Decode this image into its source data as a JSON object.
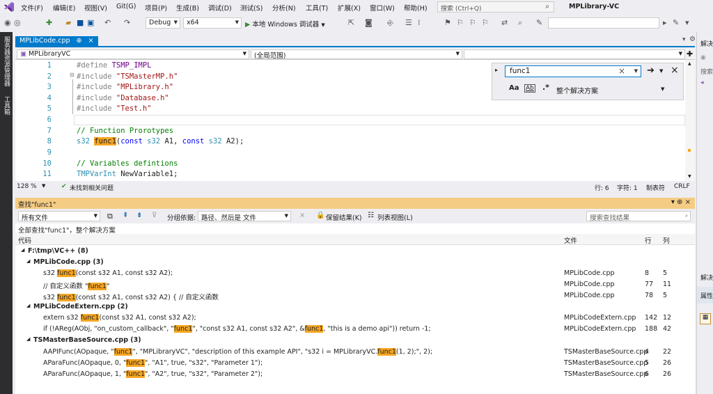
{
  "menubar": {
    "items": [
      "文件(F)",
      "编辑(E)",
      "视图(V)",
      "Git(G)",
      "项目(P)",
      "生成(B)",
      "调试(D)",
      "测试(S)",
      "分析(N)",
      "工具(T)",
      "扩展(X)",
      "窗口(W)",
      "帮助(H)"
    ],
    "search_placeholder": "搜索 (Ctrl+Q)",
    "app_title": "MPLibrary-VC"
  },
  "toolbar": {
    "config": "Debug",
    "platform": "x64",
    "run_label": "本地 Windows 调试器"
  },
  "left_strip": {
    "tab1": "服务器资源管理器",
    "tab2": "工具箱"
  },
  "doc_tab": {
    "label": "MPLibCode.cpp",
    "pin": "⊕",
    "close": "×"
  },
  "nav": {
    "project": "MPLibraryVC",
    "scope": "(全局范围)"
  },
  "editor": {
    "lines": [
      "1",
      "2",
      "3",
      "4",
      "5",
      "6",
      "7",
      "8",
      "9",
      "10",
      "11"
    ],
    "line1_kw": "#define",
    "line1_rest": " TSMP_IMPL",
    "line2_kw": "#include",
    "line2_str": " \"TSMasterMP.h\"",
    "line3_kw": "#include",
    "line3_str": " \"MPLibrary.h\"",
    "line4_kw": "#include",
    "line4_str": " \"Database.h\"",
    "line5_kw": "#include",
    "line5_str": " \"Test.h\"",
    "line7": "// Function Prorotypes",
    "line8_type": "s32",
    "line8_func": "func1",
    "line8_rest": "(",
    "line8_c1": "const",
    "line8_t1": " s32",
    "line8_a1": " A1, ",
    "line8_c2": "const",
    "line8_t2": " s32",
    "line8_a2": " A2);",
    "line10": "// Variables defintions",
    "line11_type": "TMPVarInt",
    "line11_rest": " NewVariable1;"
  },
  "find_widget": {
    "query": "func1",
    "opt_case": "Aa",
    "opt_word": "Ab",
    "opt_regex": ".*",
    "scope": "整个解决方案"
  },
  "status": {
    "zoom": "128 %",
    "issues": "未找到相关问题",
    "row": "行: 6",
    "col": "字符: 1",
    "tab": "制表符",
    "eol": "CRLF"
  },
  "find_panel": {
    "title": "查找\"func1\"",
    "scope_combo": "所有文件",
    "group_label": "分组依据:",
    "group_value": "路径、然后是 文件",
    "keep_results": "保留结果(K)",
    "list_view": "列表视图(L)",
    "search_results_placeholder": "搜索查找结果",
    "summary": "全部查找\"func1\"，整个解决方案",
    "col_code": "代码",
    "col_file": "文件",
    "col_line": "行",
    "col_col": "列",
    "root": "F:\\tmp\\VC++ (8)",
    "groups": [
      {
        "name": "MPLibCode.cpp (3)",
        "rows": [
          {
            "pre": "s32 ",
            "hit": "func1",
            "post": "(const s32 A1, const s32 A2);",
            "file": "MPLibCode.cpp",
            "line": "8",
            "col": "5"
          },
          {
            "pre": "// 自定义函数 \"",
            "hit": "func1",
            "post": "\"",
            "file": "MPLibCode.cpp",
            "line": "77",
            "col": "11"
          },
          {
            "pre": "s32 ",
            "hit": "func1",
            "post": "(const s32 A1, const s32 A2) { // 自定义函数",
            "file": "MPLibCode.cpp",
            "line": "78",
            "col": "5"
          }
        ]
      },
      {
        "name": "MPLibCodeExtern.cpp (2)",
        "rows": [
          {
            "pre": "extern s32 ",
            "hit": "func1",
            "post": "(const s32 A1, const s32 A2);",
            "file": "MPLibCodeExtern.cpp",
            "line": "142",
            "col": "12"
          },
          {
            "pre": "if (!AReg(AObj, \"on_custom_callback\", \"",
            "hit": "func1",
            "post": "\", \"const s32 A1, const s32 A2\", &",
            "hit2": "func1",
            "post2": ", \"this is a demo api\")) return -1;",
            "file": "MPLibCodeExtern.cpp",
            "line": "188",
            "col": "42"
          }
        ]
      },
      {
        "name": "TSMasterBaseSource.cpp (3)",
        "rows": [
          {
            "pre": "AAPIFunc(AOpaque, \"",
            "hit": "func1",
            "post": "\", \"MPLibraryVC\", \"description of this example API\", \"s32 i = MPLibraryVC.",
            "hit2": "func1",
            "post2": "(1, 2);\", 2);",
            "file": "TSMasterBaseSource.cpp",
            "line": "4",
            "col": "22"
          },
          {
            "pre": "AParaFunc(AOpaque, 0, \"",
            "hit": "func1",
            "post": "\", \"A1\", true, \"s32\", \"Parameter 1\");",
            "file": "TSMasterBaseSource.cpp",
            "line": "5",
            "col": "26"
          },
          {
            "pre": "AParaFunc(AOpaque, 1, \"",
            "hit": "func1",
            "post": "\", \"A2\", true, \"s32\", \"Parameter 2\");",
            "file": "TSMasterBaseSource.cpp",
            "line": "6",
            "col": "26"
          }
        ]
      }
    ]
  },
  "right_panel": {
    "label1": "解决",
    "search": "搜索",
    "label2": "解决",
    "label3": "属性"
  },
  "colors": {
    "accent": "#007acc",
    "highlight": "#f5a623",
    "find_title": "#f5cc84"
  }
}
